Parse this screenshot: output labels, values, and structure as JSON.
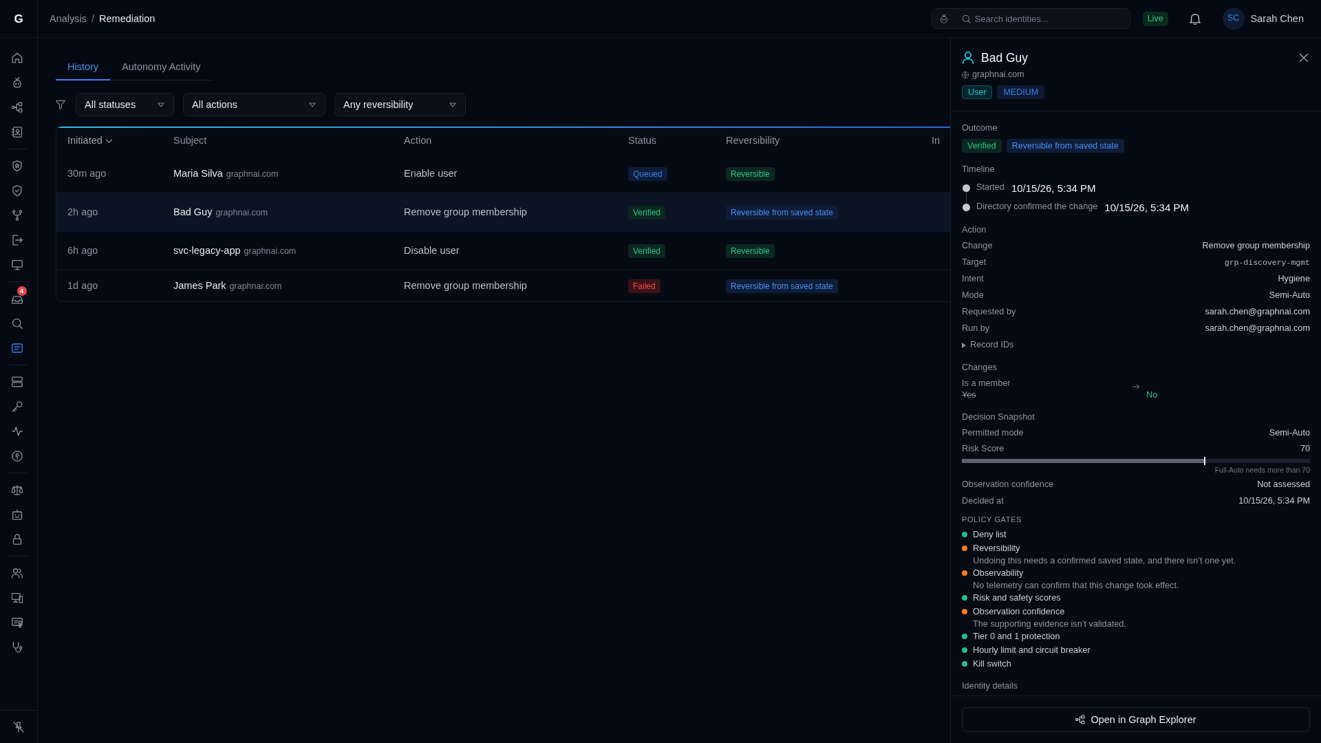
{
  "app": {
    "logo": "G"
  },
  "sidebar": {
    "groups": [
      {
        "items": [
          {
            "selected": false
          },
          {
            "selected": false
          },
          {
            "selected": false
          },
          {
            "selected": false
          }
        ]
      },
      {
        "items": [
          {
            "selected": false
          },
          {
            "selected": false
          },
          {
            "selected": false
          },
          {
            "selected": false
          },
          {
            "selected": false
          }
        ]
      },
      {
        "items": [
          {
            "selected": false,
            "badge": "4"
          },
          {
            "selected": false
          },
          {
            "selected": true
          }
        ]
      },
      {
        "items": [
          {
            "selected": false
          },
          {
            "selected": false
          },
          {
            "selected": false
          },
          {
            "selected": false
          }
        ]
      },
      {
        "items": [
          {
            "selected": false
          },
          {
            "selected": false
          },
          {
            "selected": false
          }
        ]
      },
      {
        "items": [
          {
            "selected": false
          },
          {
            "selected": false
          },
          {
            "selected": false
          },
          {
            "selected": false
          }
        ]
      }
    ]
  },
  "breadcrumb": {
    "items": [
      "Analysis",
      "Remediation"
    ],
    "separator": "/"
  },
  "search": {
    "placeholder": "Search identities..."
  },
  "connection_status": "Live",
  "user": {
    "initials": "SC",
    "name": "Sarah Chen"
  },
  "tabs": [
    {
      "label": "History",
      "selected": true
    },
    {
      "label": "Autonomy Activity",
      "selected": false
    }
  ],
  "filters": [
    {
      "value": "All statuses"
    },
    {
      "value": "All actions"
    },
    {
      "value": "Any reversibility"
    }
  ],
  "table": {
    "columns": [
      {
        "label": "Initiated",
        "sorted": true
      },
      {
        "label": "Subject",
        "sorted": false
      },
      {
        "label": "Action",
        "sorted": false
      },
      {
        "label": "Status",
        "sorted": false
      },
      {
        "label": "Reversibility",
        "sorted": false
      },
      {
        "label": "In",
        "sorted": false
      }
    ],
    "rows": [
      {
        "initiated": "30m ago",
        "name": "Maria Silva",
        "domain": "graphnai.com",
        "action": "Enable user",
        "status": {
          "text": "Queued",
          "kind": "queued"
        },
        "reversibility": {
          "text": "Reversible",
          "kind": "reversible"
        },
        "selected": false
      },
      {
        "initiated": "2h ago",
        "name": "Bad Guy",
        "domain": "graphnai.com",
        "action": "Remove group membership",
        "status": {
          "text": "Verified",
          "kind": "verified"
        },
        "reversibility": {
          "text": "Reversible from saved state",
          "kind": "saved_state"
        },
        "selected": true
      },
      {
        "initiated": "6h ago",
        "name": "svc-legacy-app",
        "domain": "graphnai.com",
        "action": "Disable user",
        "status": {
          "text": "Verified",
          "kind": "verified"
        },
        "reversibility": {
          "text": "Reversible",
          "kind": "reversible"
        },
        "selected": false
      },
      {
        "initiated": "1d ago",
        "name": "James Park",
        "domain": "graphnai.com",
        "action": "Remove group membership",
        "status": {
          "text": "Failed",
          "kind": "failed"
        },
        "reversibility": {
          "text": "Reversible from saved state",
          "kind": "saved_state"
        },
        "selected": false
      }
    ]
  },
  "detail_panel": {
    "title": "Bad Guy",
    "domain": "graphnai.com",
    "tags": [
      {
        "text": "User",
        "kind": "type"
      },
      {
        "text": "MEDIUM",
        "kind": "risk"
      }
    ],
    "outcome": {
      "heading": "Outcome",
      "badges": [
        {
          "text": "Verified",
          "kind": "verified"
        },
        {
          "text": "Reversible from saved state",
          "kind": "saved_state"
        }
      ]
    },
    "timeline": {
      "heading": "Timeline",
      "events": [
        {
          "label": "Started",
          "time": "10/15/26, 5:34 PM"
        },
        {
          "label": "Directory confirmed the change",
          "time": "10/15/26, 5:34 PM"
        }
      ]
    },
    "action": {
      "heading": "Action",
      "fields": [
        {
          "label": "Change",
          "value": "Remove group membership",
          "kind": "text"
        },
        {
          "label": "Target",
          "value": "grp-discovery-mgmt",
          "kind": "code"
        },
        {
          "label": "Intent",
          "value": "Hygiene",
          "kind": "text"
        },
        {
          "label": "Mode",
          "value": "Semi-Auto",
          "kind": "text"
        },
        {
          "label": "Requested by",
          "value": "sarah.chen@graphnai.com",
          "kind": "text"
        },
        {
          "label": "Run by",
          "value": "sarah.chen@graphnai.com",
          "kind": "text"
        }
      ],
      "record_ids": {
        "label": "Record IDs",
        "expanded": false
      }
    },
    "changes": {
      "heading": "Changes",
      "items": [
        {
          "label": "Is a member",
          "before": "Yes",
          "after": "No"
        }
      ]
    },
    "decision_snapshot": {
      "heading": "Decision Snapshot",
      "fields": [
        {
          "kind": "field",
          "label": "Permitted mode",
          "value": "Semi-Auto"
        },
        {
          "kind": "score",
          "label": "Risk Score",
          "value": "70",
          "level": 0.7,
          "note": "Full-Auto needs more than 70"
        },
        {
          "kind": "field",
          "label": "Observation confidence",
          "value": "Not assessed"
        },
        {
          "kind": "field",
          "label": "Decided at",
          "value": "10/15/26, 5:34 PM"
        }
      ]
    },
    "policy_gates": {
      "heading": "POLICY GATES",
      "gates": [
        {
          "name": "Deny list",
          "color": "#22c08a"
        },
        {
          "name": "Reversibility",
          "color": "#f47b26",
          "detail": "Undoing this needs a confirmed saved state, and there isn’t one yet."
        },
        {
          "name": "Observability",
          "color": "#f47b26",
          "detail": "No telemetry can confirm that this change took effect."
        },
        {
          "name": "Risk and safety scores",
          "color": "#22c08a"
        },
        {
          "name": "Observation confidence",
          "color": "#f47b26",
          "detail": "The supporting evidence isn’t validated."
        },
        {
          "name": "Tier 0 and 1 protection",
          "color": "#22c08a"
        },
        {
          "name": "Hourly limit and circuit breaker",
          "color": "#22c08a"
        },
        {
          "name": "Kill switch",
          "color": "#22c08a"
        }
      ]
    },
    "identity_details": {
      "heading": "Identity details"
    },
    "footer_button": {
      "label": "Open in Graph Explorer"
    }
  }
}
